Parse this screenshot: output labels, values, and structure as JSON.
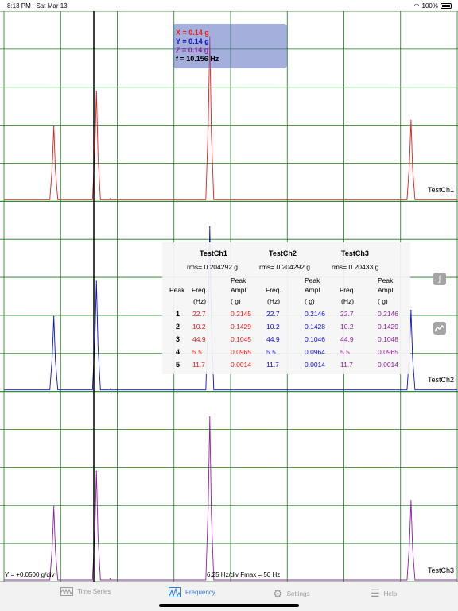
{
  "status_bar": {
    "time": "8:13 PM",
    "date": "Sat Mar 13",
    "battery": "100%"
  },
  "channels": [
    {
      "label": "TestCh1",
      "color": "#e02020"
    },
    {
      "label": "TestCh2",
      "color": "#1010d0"
    },
    {
      "label": "TestCh3",
      "color": "#9020a0"
    }
  ],
  "cursor_readout": {
    "x": "X = 0.14  g",
    "y": "Y = 0.14  g",
    "z": "Z = 0.14  g",
    "f": "f = 10.156 Hz"
  },
  "peak_table": {
    "channels": [
      {
        "name": "TestCh1",
        "rms": "rms= 0.204292 g"
      },
      {
        "name": "TestCh2",
        "rms": "rms= 0.204292 g"
      },
      {
        "name": "TestCh3",
        "rms": "rms= 0.20433 g"
      }
    ],
    "col_peak": "Peak",
    "col_freq": [
      "Freq.",
      "(Hz)"
    ],
    "col_ampl": [
      "Peak",
      "Ampl",
      "( g)"
    ],
    "rows": [
      {
        "peak": "1",
        "ch1": [
          "22.7",
          "0.2145"
        ],
        "ch2": [
          "22.7",
          "0.2146"
        ],
        "ch3": [
          "22.7",
          "0.2146"
        ]
      },
      {
        "peak": "2",
        "ch1": [
          "10.2",
          "0.1429"
        ],
        "ch2": [
          "10.2",
          "0.1428"
        ],
        "ch3": [
          "10.2",
          "0.1429"
        ]
      },
      {
        "peak": "3",
        "ch1": [
          "44.9",
          "0.1045"
        ],
        "ch2": [
          "44.9",
          "0.1046"
        ],
        "ch3": [
          "44.9",
          "0.1048"
        ]
      },
      {
        "peak": "4",
        "ch1": [
          "5.5",
          "0.0965"
        ],
        "ch2": [
          "5.5",
          "0.0964"
        ],
        "ch3": [
          "5.5",
          "0.0965"
        ]
      },
      {
        "peak": "5",
        "ch1": [
          "11.7",
          "0.0014"
        ],
        "ch2": [
          "11.7",
          "0.0014"
        ],
        "ch3": [
          "11.7",
          "0.0014"
        ]
      }
    ]
  },
  "scale": {
    "y": "Y = +0.0500 g/div",
    "x": "6.25 Hz/div  Fmax = 50 Hz"
  },
  "tabs": [
    {
      "label": "Time Series",
      "icon": "time-series-icon"
    },
    {
      "label": "Frequency",
      "icon": "frequency-icon"
    },
    {
      "label": "Settings",
      "icon": "gear-icon"
    },
    {
      "label": "Help",
      "icon": "list-icon"
    }
  ],
  "side_icons": [
    "integral-icon",
    "chart-icon"
  ],
  "chart_data": {
    "type": "line",
    "xlabel": "",
    "ylabel": "",
    "xlim": [
      0,
      50
    ],
    "x_per_div": 6.25,
    "y_per_div": 0.05,
    "cursor_frequency": 10.156,
    "series": [
      {
        "name": "TestCh1",
        "color": "#e02020",
        "peaks": [
          [
            5.5,
            0.0965
          ],
          [
            10.2,
            0.1429
          ],
          [
            11.7,
            0.0014
          ],
          [
            22.7,
            0.2145
          ],
          [
            44.9,
            0.1045
          ]
        ]
      },
      {
        "name": "TestCh2",
        "color": "#1010d0",
        "peaks": [
          [
            5.5,
            0.0964
          ],
          [
            10.2,
            0.1428
          ],
          [
            11.7,
            0.0014
          ],
          [
            22.7,
            0.2146
          ],
          [
            44.9,
            0.1046
          ]
        ]
      },
      {
        "name": "TestCh3",
        "color": "#9020a0",
        "peaks": [
          [
            5.5,
            0.0965
          ],
          [
            10.2,
            0.1429
          ],
          [
            11.7,
            0.0014
          ],
          [
            22.7,
            0.2146
          ],
          [
            44.9,
            0.1048
          ]
        ]
      }
    ]
  }
}
